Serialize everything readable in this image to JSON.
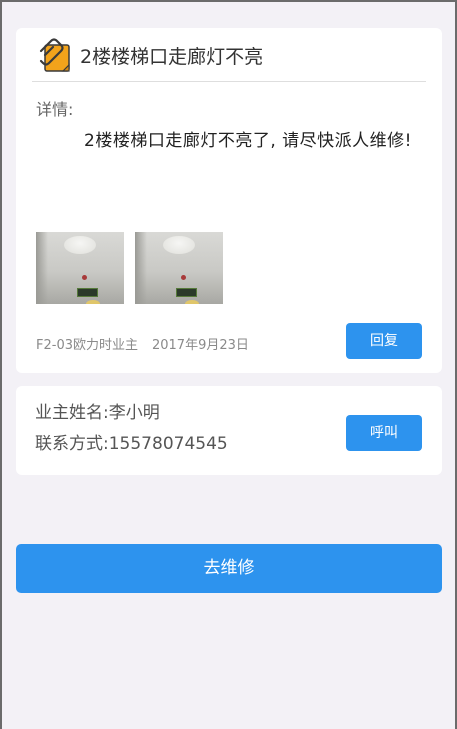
{
  "notice": {
    "icon": "notepad-clip-icon",
    "title": "2楼楼梯口走廊灯不亮",
    "details_label": "详情:",
    "details_text": "2楼楼梯口走廊灯不亮了, 请尽快派人维修!",
    "photos": [
      {
        "name": "photo-thumbnail-1"
      },
      {
        "name": "photo-thumbnail-2"
      }
    ],
    "submitter": "F2-03欧力时业主",
    "date": "2017年9月23日",
    "reply_label": "回复"
  },
  "owner": {
    "name_label": "业主姓名:",
    "name": "李小明",
    "phone_label": "联系方式:",
    "phone": "15578074545",
    "call_label": "呼叫"
  },
  "actions": {
    "repair_label": "去维修"
  },
  "colors": {
    "accent": "#2d93ee",
    "background": "#f3f1f6",
    "card": "#ffffff",
    "icon_orange": "#f2a31b"
  }
}
